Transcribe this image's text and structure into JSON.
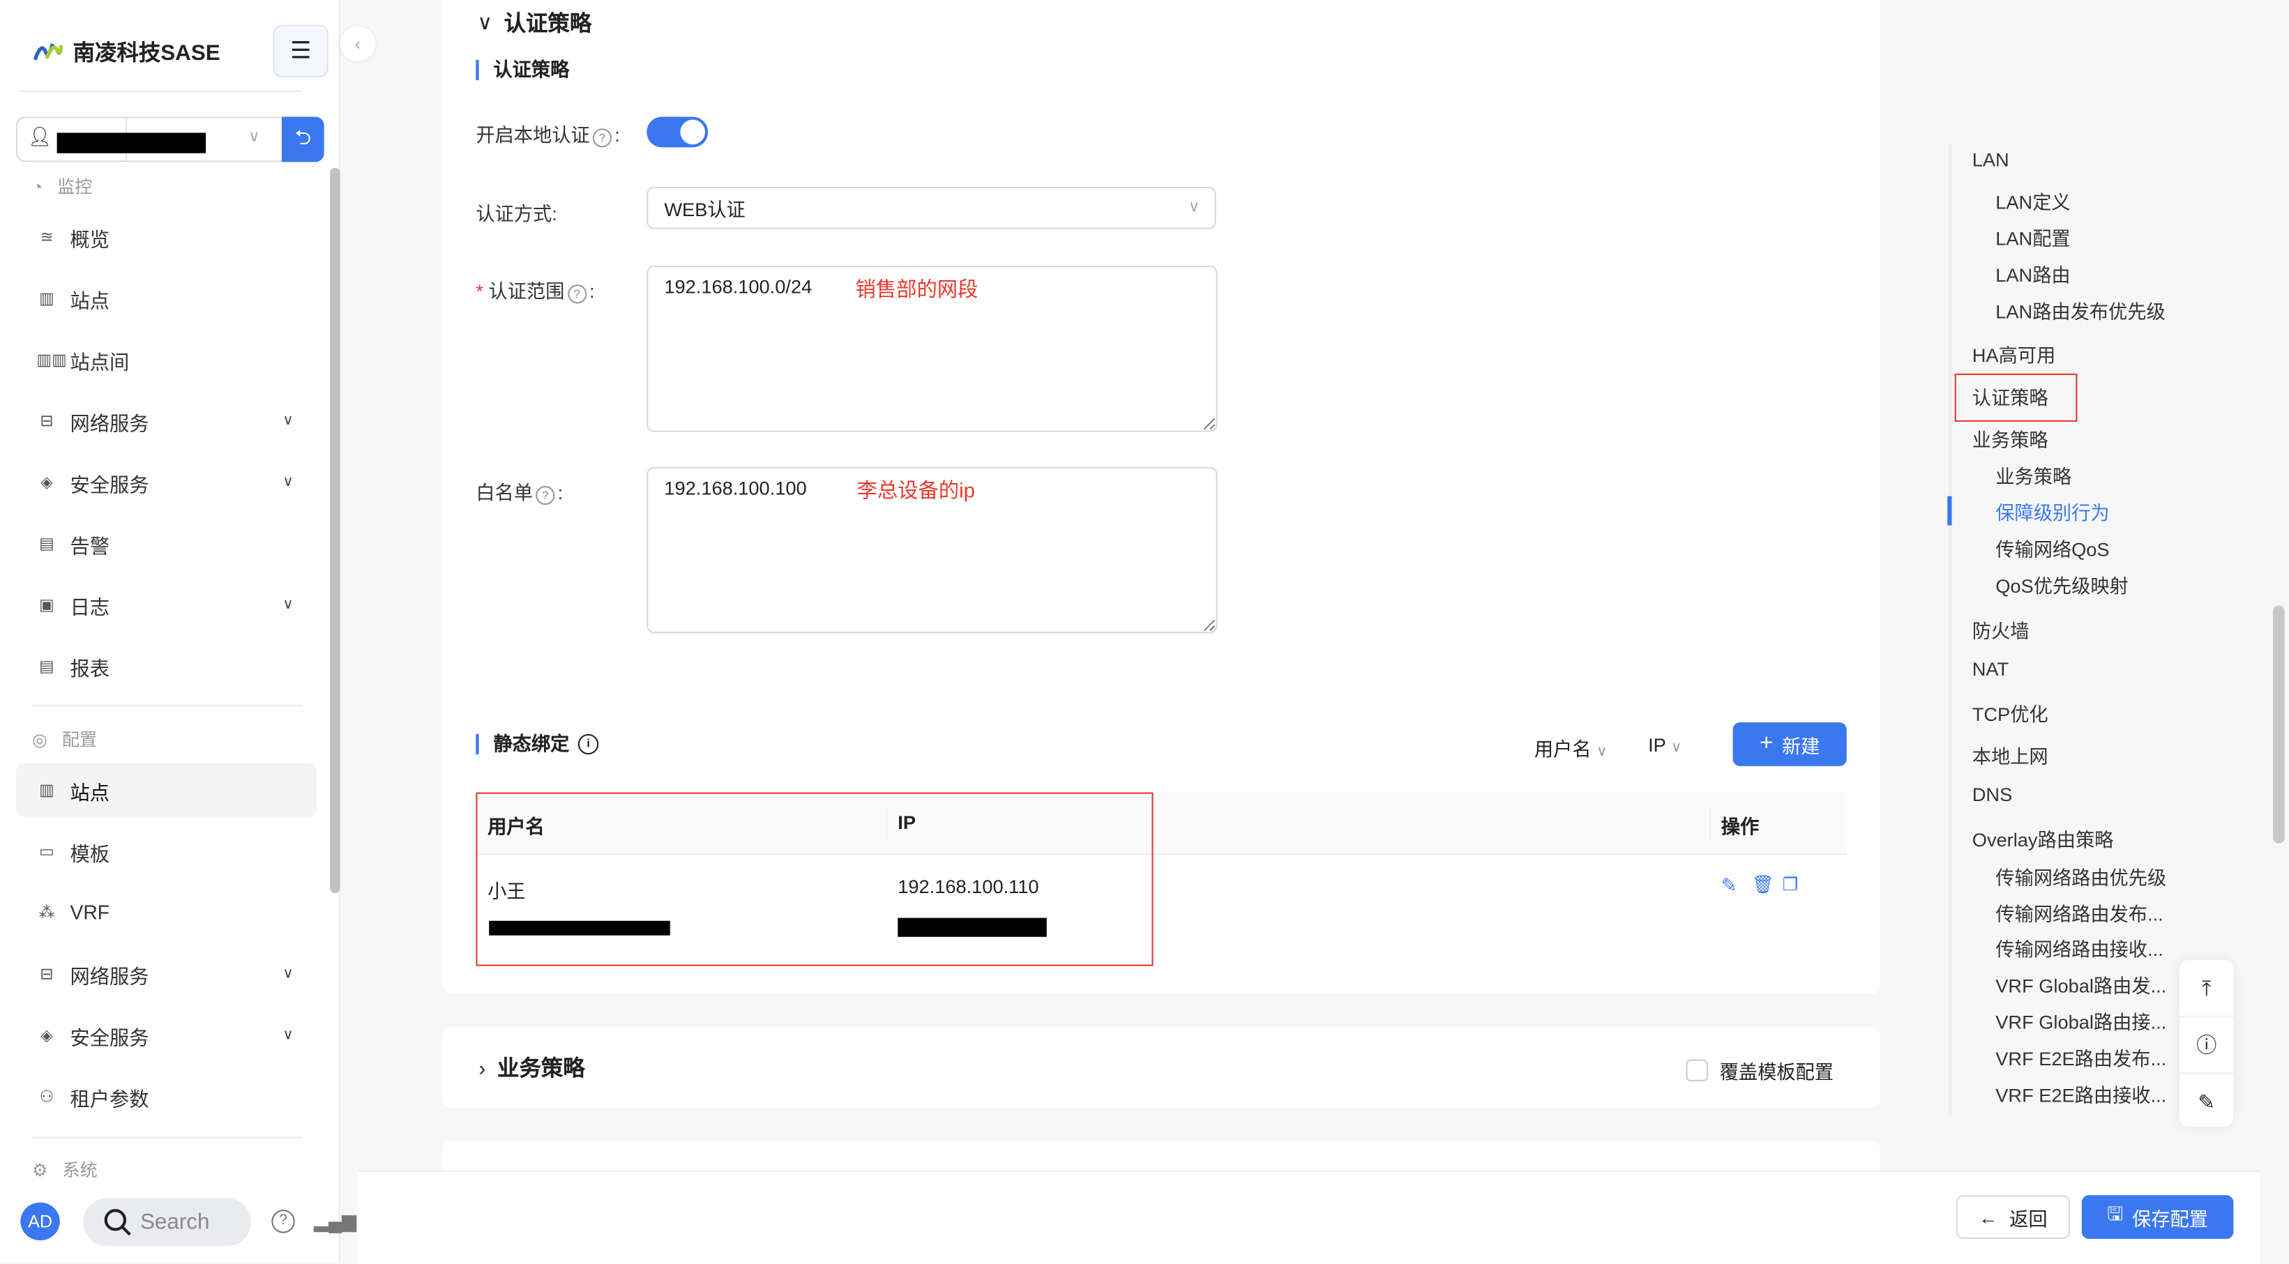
{
  "colors": {
    "accent": "#3b78f0",
    "annotation": "#e8392b"
  },
  "sidebar": {
    "brand": "南凌科技SASE",
    "user_select_icon": "user-icon",
    "groups": [
      {
        "label": "监控",
        "icon": "dashboard-icon",
        "items": [
          {
            "label": "概览",
            "icon": "overview-icon"
          },
          {
            "label": "站点",
            "icon": "building-icon"
          },
          {
            "label": "站点间",
            "icon": "buildings-icon"
          },
          {
            "label": "网络服务",
            "icon": "network-icon",
            "expandable": true
          },
          {
            "label": "安全服务",
            "icon": "shield-icon",
            "expandable": true
          },
          {
            "label": "告警",
            "icon": "alarm-icon"
          },
          {
            "label": "日志",
            "icon": "log-icon",
            "expandable": true
          },
          {
            "label": "报表",
            "icon": "report-icon"
          }
        ]
      },
      {
        "label": "配置",
        "icon": "config-icon",
        "items": [
          {
            "label": "站点",
            "icon": "building-icon",
            "active": true
          },
          {
            "label": "模板",
            "icon": "template-icon"
          },
          {
            "label": "VRF",
            "icon": "vrf-icon"
          },
          {
            "label": "网络服务",
            "icon": "network-icon",
            "expandable": true
          },
          {
            "label": "安全服务",
            "icon": "shield-icon",
            "expandable": true
          },
          {
            "label": "租户参数",
            "icon": "tenant-icon"
          }
        ]
      },
      {
        "label": "系统",
        "icon": "gear-icon",
        "items": []
      }
    ],
    "avatar": "AD",
    "search_placeholder": "Search"
  },
  "main": {
    "section_title": "认证策略",
    "subsection_title": "认证策略",
    "form": {
      "local_auth_label": "开启本地认证",
      "local_auth_enabled": true,
      "auth_method_label": "认证方式:",
      "auth_method_value": "WEB认证",
      "auth_scope_label": "认证范围",
      "auth_scope_value": "192.168.100.0/24",
      "auth_scope_annotation": "销售部的网段",
      "whitelist_label": "白名单",
      "whitelist_value": "192.168.100.100",
      "whitelist_annotation": "李总设备的ip"
    },
    "static_binding": {
      "title": "静态绑定",
      "filter_username": "用户名",
      "filter_ip": "IP",
      "new_button": "新建",
      "columns": [
        "用户名",
        "IP",
        "操作"
      ],
      "rows": [
        {
          "username": "小王",
          "ip": "192.168.100.110"
        }
      ]
    },
    "business_section": {
      "title": "业务策略",
      "override_label": "覆盖模板配置",
      "override_checked": false
    }
  },
  "footer": {
    "back_label": "返回",
    "save_label": "保存配置"
  },
  "anchor_nav": [
    {
      "label": "LAN",
      "level": 1
    },
    {
      "label": "LAN定义",
      "level": 2
    },
    {
      "label": "LAN配置",
      "level": 2
    },
    {
      "label": "LAN路由",
      "level": 2
    },
    {
      "label": "LAN路由发布优先级",
      "level": 2
    },
    {
      "label": "HA高可用",
      "level": 1
    },
    {
      "label": "认证策略",
      "level": 1,
      "highlighted": true
    },
    {
      "label": "业务策略",
      "level": 1
    },
    {
      "label": "业务策略",
      "level": 2
    },
    {
      "label": "保障级别行为",
      "level": 2,
      "active": true
    },
    {
      "label": "传输网络QoS",
      "level": 2
    },
    {
      "label": "QoS优先级映射",
      "level": 2
    },
    {
      "label": "防火墙",
      "level": 1
    },
    {
      "label": "NAT",
      "level": 1
    },
    {
      "label": "TCP优化",
      "level": 1
    },
    {
      "label": "本地上网",
      "level": 1
    },
    {
      "label": "DNS",
      "level": 1
    },
    {
      "label": "Overlay路由策略",
      "level": 1
    },
    {
      "label": "传输网络路由优先级",
      "level": 2
    },
    {
      "label": "传输网络路由发布...",
      "level": 2
    },
    {
      "label": "传输网络路由接收...",
      "level": 2
    },
    {
      "label": "VRF Global路由发...",
      "level": 2
    },
    {
      "label": "VRF Global路由接...",
      "level": 2
    },
    {
      "label": "VRF E2E路由发布...",
      "level": 2
    },
    {
      "label": "VRF E2E路由接收...",
      "level": 2
    }
  ]
}
